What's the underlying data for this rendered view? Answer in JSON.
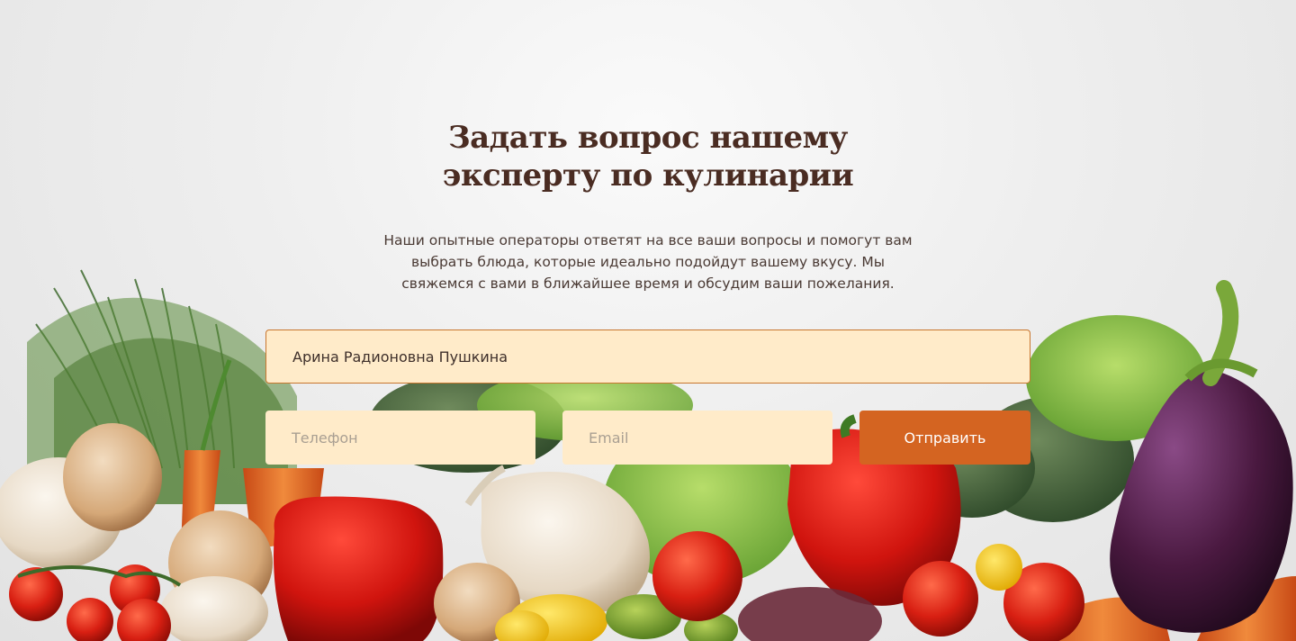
{
  "section": {
    "title_line1": "Задать вопрос нашему",
    "title_line2": "эксперту по кулинарии",
    "description_line1": "Наши опытные операторы ответят на все ваши вопросы и помогут вам",
    "description_line2": "выбрать блюда, которые идеально подойдут вашему вкусу. Мы",
    "description_line3": "свяжемся с вами в ближайшее время и обсудим ваши пожелания."
  },
  "form": {
    "name_value": "Арина Радионовна Пушкина",
    "phone_placeholder": "Телефон",
    "email_placeholder": "Email",
    "submit_label": "Отправить"
  },
  "colors": {
    "title": "#4a2c22",
    "field_bg": "#ffebc9",
    "field_border_active": "#c8762e",
    "button_bg": "#d46421"
  }
}
